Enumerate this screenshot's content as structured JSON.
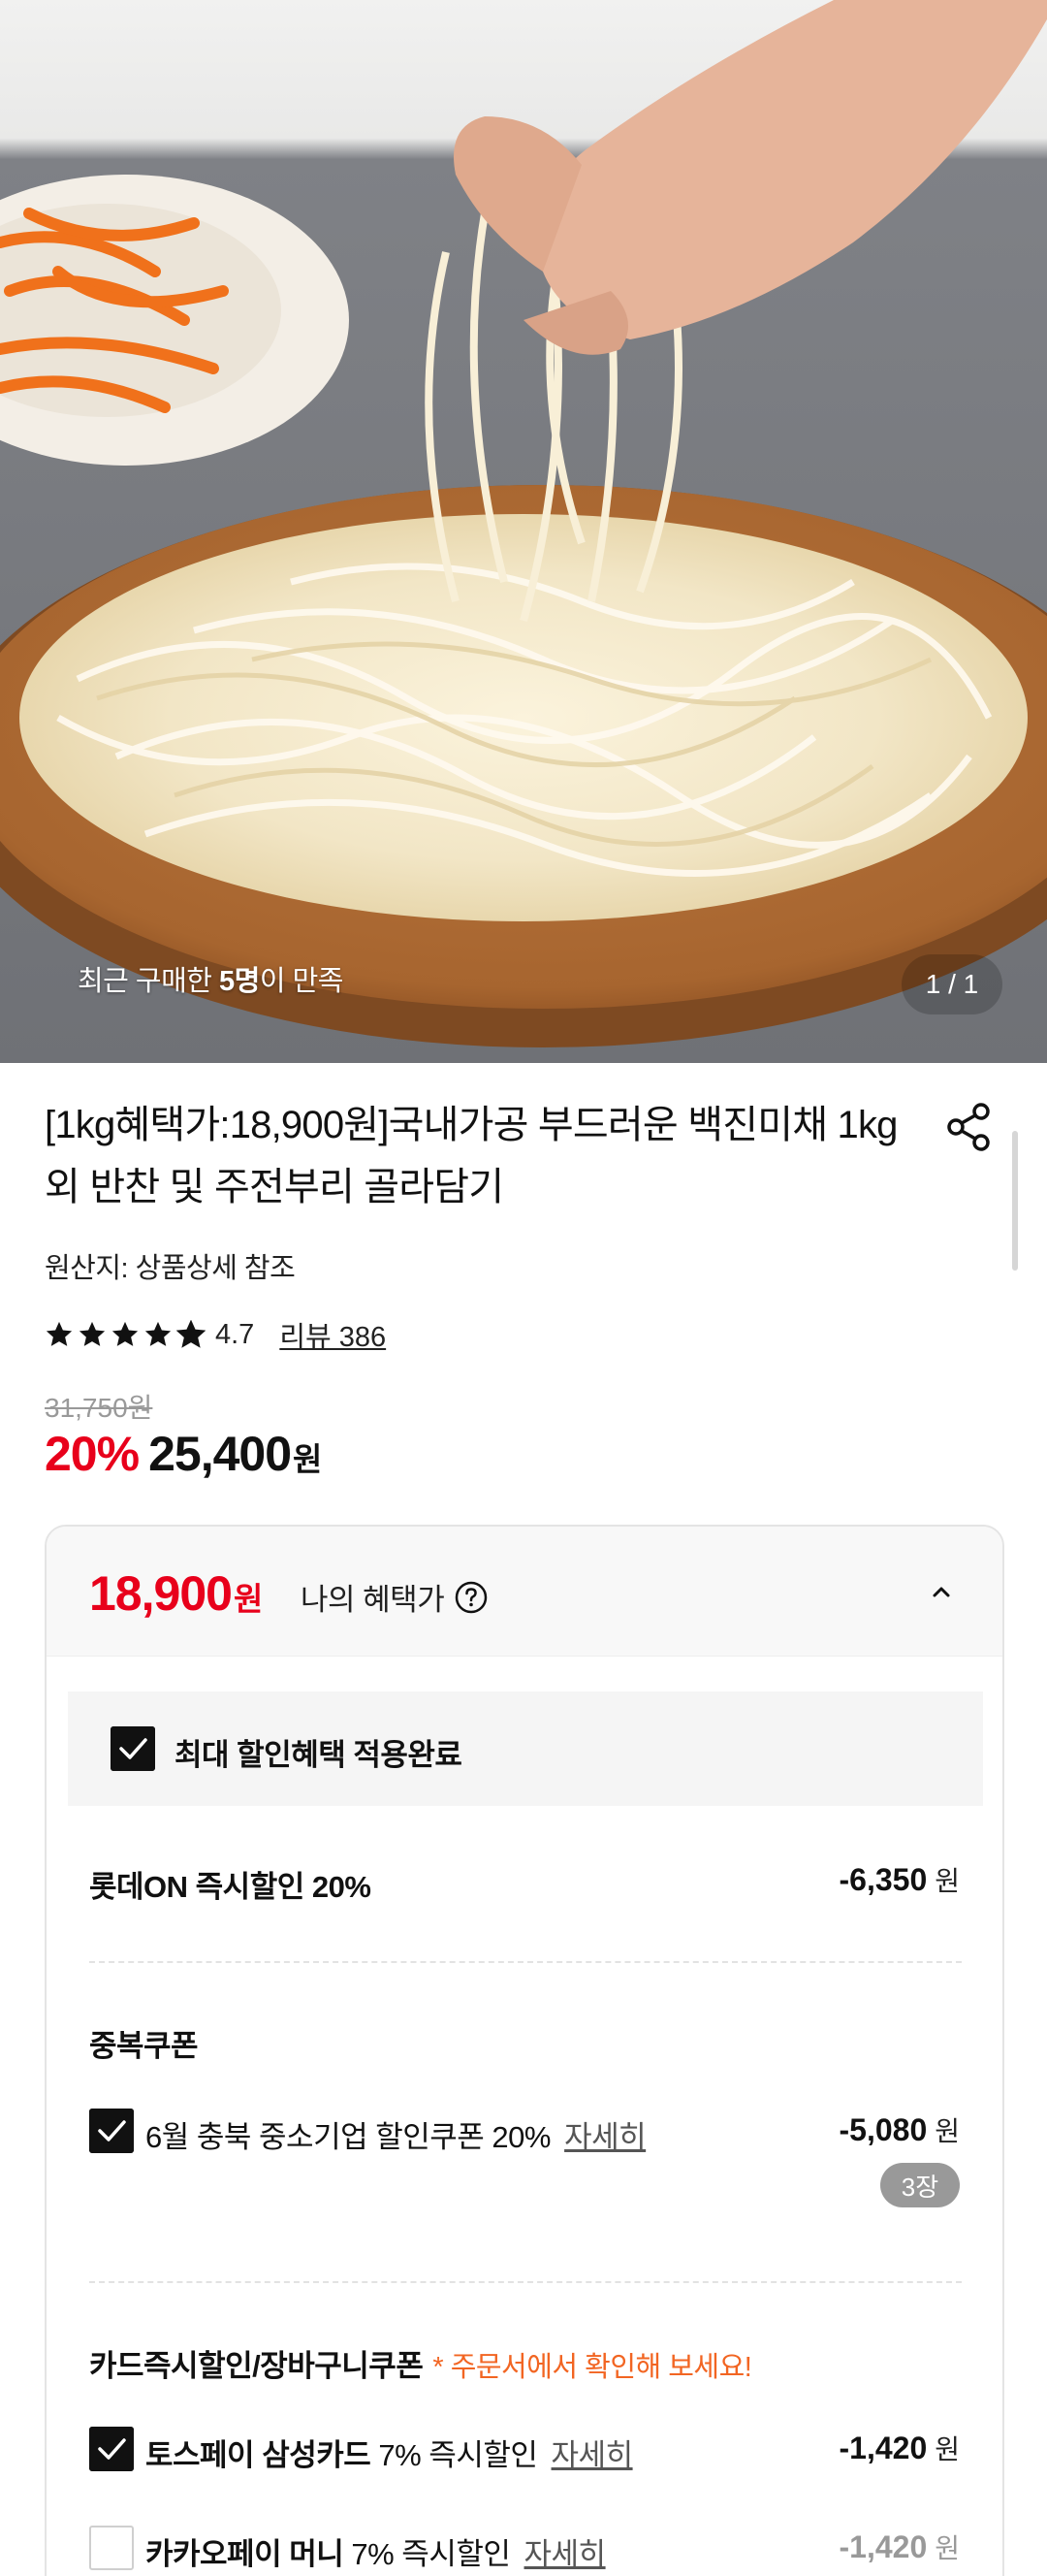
{
  "hero": {
    "caption_prefix": "최근 구매한 ",
    "caption_count": "5명",
    "caption_suffix": "이 만족",
    "counter": "1 / 1"
  },
  "product": {
    "title": "[1kg혜택가:18,900원]국내가공 부드러운 백진미채 1kg 외 반찬 및 주전부리 골라담기",
    "origin": "원산지: 상품상세 참조",
    "rating": "4.7",
    "rating_stars": 4.7,
    "review_link": "리뷰 386",
    "original_price": "31,750원",
    "discount_rate": "20%",
    "sale_price": "25,400",
    "sale_price_unit": "원"
  },
  "benefit": {
    "my_price": "18,900",
    "my_price_unit": "원",
    "my_price_label": "나의 혜택가",
    "max_benefit_label": "최대 할인혜택 적용완료",
    "instant_label": "롯데ON 즉시할인 20%",
    "instant_amount": "-6,350",
    "won": "원",
    "coupon_section": "중복쿠폰",
    "coupon_label": "6월 충북 중소기업 할인쿠폰 20%",
    "detail_link": "자세히",
    "coupon_amount": "-5,080",
    "coupon_count": "3장",
    "card_section": "카드즉시할인/장바구니쿠폰",
    "card_note": "* 주문서에서 확인해 보세요!",
    "toss_bold": "토스페이 삼성카드",
    "toss_rest": " 7% 즉시할인",
    "toss_amount": "-1,420",
    "kakao_bold": "카카오페이 머니",
    "kakao_rest": " 7% 즉시할인",
    "kakao_amount": "-1,420"
  },
  "colors": {
    "accent_red": "#e8001b",
    "note_orange": "#f26522",
    "checkbox_on": "#111111"
  }
}
